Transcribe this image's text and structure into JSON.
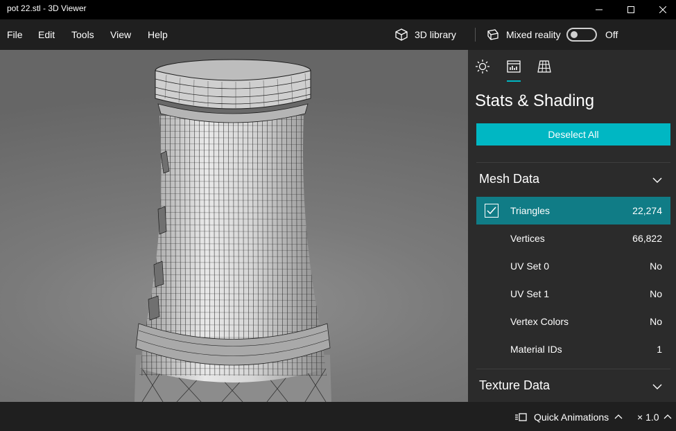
{
  "window": {
    "title": "pot 22.stl - 3D Viewer",
    "minimize_glyph": "—",
    "maximize_glyph": "☐",
    "close_glyph": "✕"
  },
  "menu": {
    "items": [
      "File",
      "Edit",
      "Tools",
      "View",
      "Help"
    ],
    "library_label": "3D library",
    "mixed_reality_label": "Mixed reality",
    "toggle_state": "Off"
  },
  "panel": {
    "tabs": [
      "sun-icon",
      "stats-icon",
      "grid-icon"
    ],
    "active_tab": "stats-icon",
    "title": "Stats & Shading",
    "deselect_label": "Deselect All",
    "mesh_section": "Mesh Data",
    "rows": [
      {
        "label": "Triangles",
        "value": "22,274",
        "checked": true
      },
      {
        "label": "Vertices",
        "value": "66,822"
      },
      {
        "label": "UV Set 0",
        "value": "No"
      },
      {
        "label": "UV Set 1",
        "value": "No"
      },
      {
        "label": "Vertex Colors",
        "value": "No"
      },
      {
        "label": "Material IDs",
        "value": "1"
      }
    ],
    "texture_section": "Texture Data"
  },
  "status": {
    "animations_label": "Quick Animations",
    "speed": "× 1.0"
  },
  "colors": {
    "accent": "#00b7c3",
    "selected_row": "#107c86",
    "panel_bg": "#2b2b2b",
    "chrome_bg": "#1f1f1f"
  }
}
